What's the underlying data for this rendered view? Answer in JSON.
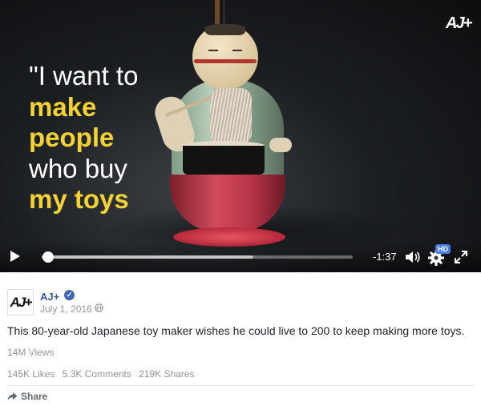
{
  "video": {
    "quote_lines": [
      {
        "text": "\"I want to",
        "style": "light"
      },
      {
        "text": "make",
        "style": "highlight"
      },
      {
        "text": "people",
        "style": "highlight"
      },
      {
        "text": "who buy",
        "style": "light"
      },
      {
        "text": "my toys",
        "style": "highlight"
      }
    ],
    "corner_logo": "AJ+",
    "highlight_color": "#f4d233",
    "controls": {
      "time_remaining": "-1:37",
      "hd_badge": "HD",
      "progress_fraction": 0.02,
      "buffered_fraction": 0.68,
      "play_icon": "play-icon",
      "volume_icon": "volume-icon",
      "settings_icon": "gear-icon",
      "fullscreen_icon": "fullscreen-icon"
    }
  },
  "post": {
    "avatar_text": "AJ+",
    "page_name": "AJ+",
    "verified_mark": "✓",
    "date": "July 1, 2016 ·",
    "privacy_icon": "globe-icon",
    "message": "This 80-year-old Japanese toy maker wishes he could live to 200 to keep making more toys.",
    "views": "14M Views",
    "likes": "145K Likes",
    "comments": "5.3K Comments",
    "shares": "219K Shares",
    "share_label": "Share",
    "link_color": "#365899"
  }
}
